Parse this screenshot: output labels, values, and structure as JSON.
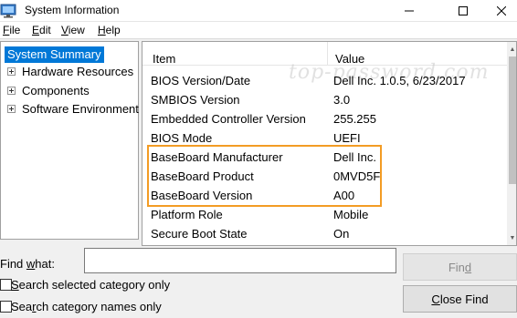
{
  "window": {
    "title": "System Information",
    "minimize_glyph": "—",
    "maximize_glyph": "☐",
    "close_glyph": "✕"
  },
  "menu": {
    "items": [
      {
        "label": "File",
        "hotkey": "F"
      },
      {
        "label": "Edit",
        "hotkey": "E"
      },
      {
        "label": "View",
        "hotkey": "V"
      },
      {
        "label": "Help",
        "hotkey": "H"
      }
    ]
  },
  "tree": {
    "root": "System Summary",
    "children": [
      {
        "label": "Hardware Resources"
      },
      {
        "label": "Components"
      },
      {
        "label": "Software Environment"
      }
    ]
  },
  "list": {
    "columns": {
      "item": "Item",
      "value": "Value"
    },
    "watermark": "top-password.com",
    "rows": [
      {
        "item": "BIOS Version/Date",
        "value": "Dell Inc. 1.0.5, 6/23/2017"
      },
      {
        "item": "SMBIOS Version",
        "value": "3.0"
      },
      {
        "item": "Embedded Controller Version",
        "value": "255.255"
      },
      {
        "item": "BIOS Mode",
        "value": "UEFI"
      },
      {
        "item": "BaseBoard Manufacturer",
        "value": "Dell Inc."
      },
      {
        "item": "BaseBoard Product",
        "value": "0MVD5F"
      },
      {
        "item": "BaseBoard Version",
        "value": "A00"
      },
      {
        "item": "Platform Role",
        "value": "Mobile"
      },
      {
        "item": "Secure Boot State",
        "value": "On"
      }
    ],
    "highlight_color": "#f39c24"
  },
  "find": {
    "label_prefix": "Find ",
    "label_hotkey": "w",
    "label_suffix": "hat:",
    "input_value": "",
    "find_button_prefix": "Fin",
    "find_button_hotkey": "d",
    "search_selected": {
      "hotkey": "S",
      "rest": "earch selected category only"
    },
    "search_names": {
      "prefix": "Sea",
      "hotkey": "r",
      "rest": "ch category names only"
    },
    "close_button": {
      "hotkey": "C",
      "rest": "lose Find"
    }
  },
  "colors": {
    "selection": "#0078d7"
  }
}
